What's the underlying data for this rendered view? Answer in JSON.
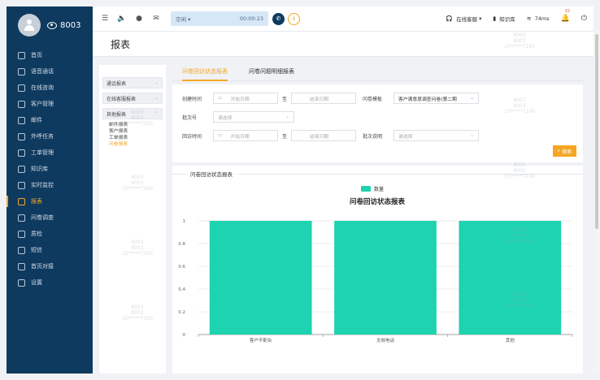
{
  "header": {
    "extension": "8003",
    "status": "空闲",
    "timer": "00:00:23",
    "online_service_label": "在线客服",
    "knowledge_label": "知识库",
    "latency": "74ms",
    "notification_count": "32"
  },
  "sidebar": {
    "items": [
      {
        "label": "首页",
        "icon": "home-icon"
      },
      {
        "label": "语音通话",
        "icon": "phone-icon"
      },
      {
        "label": "在线咨询",
        "icon": "headset-icon"
      },
      {
        "label": "客户管理",
        "icon": "users-icon"
      },
      {
        "label": "邮件",
        "icon": "mail-icon"
      },
      {
        "label": "外呼任务",
        "icon": "outbound-icon"
      },
      {
        "label": "工单管理",
        "icon": "ticket-icon"
      },
      {
        "label": "知识库",
        "icon": "book-icon"
      },
      {
        "label": "实时监控",
        "icon": "monitor-icon"
      },
      {
        "label": "报表",
        "icon": "chart-icon"
      },
      {
        "label": "问卷调查",
        "icon": "survey-icon"
      },
      {
        "label": "质检",
        "icon": "quality-icon"
      },
      {
        "label": "短信",
        "icon": "sms-icon"
      },
      {
        "label": "首页对接",
        "icon": "link-icon"
      },
      {
        "label": "设置",
        "icon": "gear-icon"
      }
    ],
    "active_index": 9
  },
  "page": {
    "title": "报表"
  },
  "tree": {
    "groups": [
      "通话报表",
      "在线客服报表",
      "其他报表"
    ],
    "sub_items": [
      "邮件报表",
      "客户报表",
      "工单报表",
      "问卷报表"
    ],
    "active_sub": "问卷报表"
  },
  "tabs": [
    "问卷回访状态报表",
    "问卷问题明细报表"
  ],
  "form": {
    "create_time_label": "创建时间",
    "start_date_placeholder": "开始日期",
    "to_label": "至",
    "end_date_placeholder": "结束日期",
    "template_label": "问卷模板",
    "template_value": "客户满意度调查问卷(第二期",
    "batch_label": "批次号",
    "select_placeholder": "请选择",
    "callback_time_label": "回访时间",
    "batch_desc_label": "批次说明",
    "search_label": "搜索"
  },
  "chart_panel": {
    "title": "问卷回访状态报表"
  },
  "chart_data": {
    "type": "bar",
    "title": "问卷回访状态报表",
    "categories": [
      "客户不配合",
      "无效电话",
      "其他"
    ],
    "series": [
      {
        "name": "数量",
        "values": [
          1,
          1,
          1
        ]
      }
    ],
    "ylim": [
      0,
      1
    ],
    "yticks": [
      "0",
      "0.2",
      "0.4",
      "0.6",
      "0.8",
      "1"
    ],
    "color": "#1dd3b0",
    "grid": true,
    "legend": "top-center"
  },
  "watermark": {
    "line1": "8003",
    "line2": "8003",
    "line3": "15*****7190"
  }
}
